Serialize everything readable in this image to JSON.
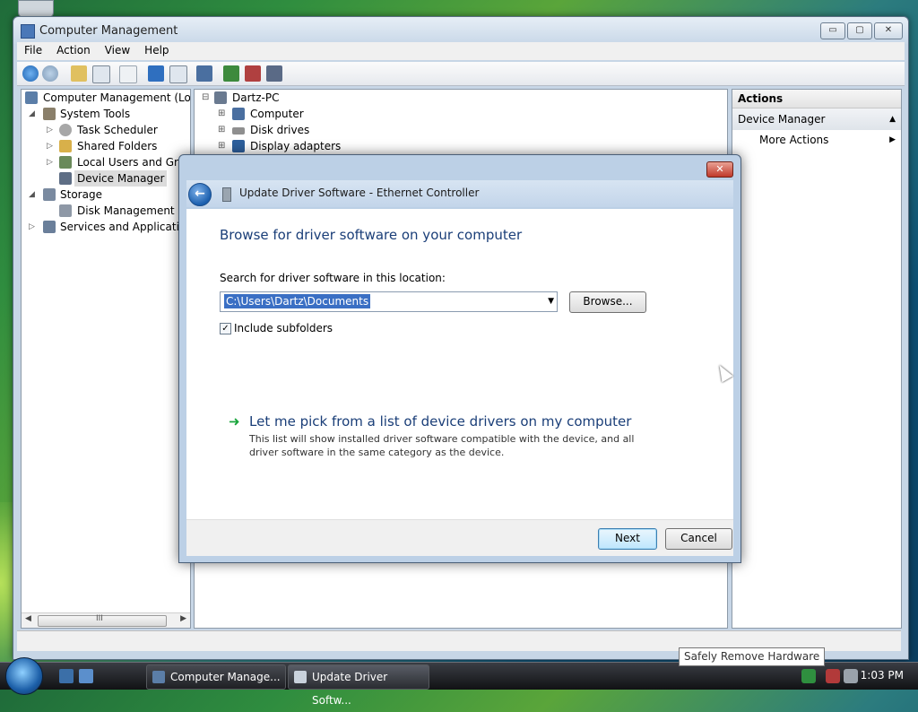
{
  "main_window": {
    "title": "Computer Management",
    "controls": {
      "minimize": "▭",
      "maximize": "▢",
      "close": "✕"
    }
  },
  "menubar": [
    "File",
    "Action",
    "View",
    "Help"
  ],
  "toolbar": [
    "back-icon",
    "forward-icon",
    "up-icon",
    "show-hide-tree-icon",
    "properties-icon",
    "help-icon",
    "show-hide-action-pane-icon",
    "scan-hardware-icon",
    "update-driver-icon",
    "disable-device-icon",
    "uninstall-device-icon"
  ],
  "tree": {
    "items": [
      {
        "label": "Computer Management (Local",
        "expander": "",
        "icon_color": "#5b7ea8"
      },
      {
        "label": "System Tools",
        "expander": "◢",
        "icon_color": "#8a7f6a"
      },
      {
        "label": "Task Scheduler",
        "expander": "▷",
        "icon_color": "#a7a7a7"
      },
      {
        "label": "Shared Folders",
        "expander": "▷",
        "icon_color": "#d8b04a"
      },
      {
        "label": "Local Users and Group",
        "expander": "▷",
        "icon_color": "#6a8a5a"
      },
      {
        "label": "Device Manager",
        "expander": "",
        "icon_color": "#5e6e85",
        "selected": true
      },
      {
        "label": "Storage",
        "expander": "◢",
        "icon_color": "#7a8aa0"
      },
      {
        "label": "Disk Management",
        "expander": "",
        "icon_color": "#8e98a6"
      },
      {
        "label": "Services and Applications",
        "expander": "▷",
        "icon_color": "#6a7f9a"
      }
    ],
    "scroll": {
      "left": "◀",
      "grip": "III",
      "right": "▶"
    }
  },
  "devices": {
    "root": "Dartz-PC",
    "root_expander": "⊟",
    "items": [
      {
        "label": "Computer",
        "expander": "⊞",
        "icon_color": "#4a6fa0"
      },
      {
        "label": "Disk drives",
        "expander": "⊞",
        "icon_color": "#8f8f8f"
      },
      {
        "label": "Display adapters",
        "expander": "⊞",
        "icon_color": "#2d5f9c"
      }
    ]
  },
  "actions": {
    "header": "Actions",
    "section": "Device Manager",
    "section_arrow": "▲",
    "items": [
      {
        "label": "More Actions",
        "arrow": "▶"
      }
    ]
  },
  "dialog": {
    "title": "Update Driver Software - Ethernet Controller",
    "back_glyph": "←",
    "close_glyph": "✕",
    "heading": "Browse for driver software on your computer",
    "search_label": "Search for driver software in this location:",
    "path_value": "C:\\Users\\Dartz\\Documents",
    "dropdown_glyph": "▼",
    "browse_label": "Browse...",
    "include_subfolders": {
      "label": "Include subfolders",
      "checked": true,
      "mark": "✓"
    },
    "pick_link": {
      "arrow": "➜",
      "title": "Let me pick from a list of device drivers on my computer",
      "description": "This list will show installed driver software compatible with the device, and all driver software in the same category as the device."
    },
    "next_label": "Next",
    "cancel_label": "Cancel"
  },
  "taskbar": {
    "tasks": [
      {
        "label": "Computer Manage...",
        "active": false
      },
      {
        "label": "Update Driver Softw...",
        "active": true
      }
    ],
    "tooltip": "Safely Remove Hardware",
    "clock": "1:03 PM"
  },
  "colors": {
    "dialog_heading": "#1a3e78",
    "link_arrow": "#1aa53c",
    "selection": "#3a6fc4",
    "close_red": "#c0392b"
  }
}
